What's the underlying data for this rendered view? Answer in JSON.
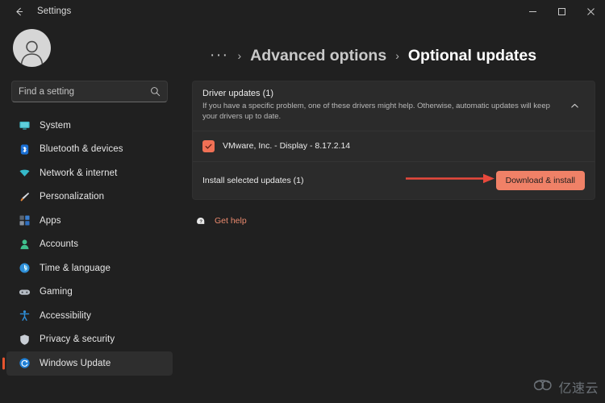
{
  "window": {
    "title": "Settings",
    "back_icon": "back-arrow-icon",
    "controls": {
      "minimize": "minimize-icon",
      "maximize": "maximize-icon",
      "close": "close-icon"
    }
  },
  "sidebar": {
    "avatar": "user-avatar",
    "search": {
      "placeholder": "Find a setting",
      "icon": "search-icon",
      "value": ""
    },
    "items": [
      {
        "label": "System",
        "icon": "monitor-icon",
        "active": false
      },
      {
        "label": "Bluetooth & devices",
        "icon": "bluetooth-icon",
        "active": false
      },
      {
        "label": "Network & internet",
        "icon": "wifi-icon",
        "active": false
      },
      {
        "label": "Personalization",
        "icon": "paintbrush-icon",
        "active": false
      },
      {
        "label": "Apps",
        "icon": "apps-grid-icon",
        "active": false
      },
      {
        "label": "Accounts",
        "icon": "person-icon",
        "active": false
      },
      {
        "label": "Time & language",
        "icon": "clock-icon",
        "active": false
      },
      {
        "label": "Gaming",
        "icon": "gamepad-icon",
        "active": false
      },
      {
        "label": "Accessibility",
        "icon": "accessibility-icon",
        "active": false
      },
      {
        "label": "Privacy & security",
        "icon": "shield-icon",
        "active": false
      },
      {
        "label": "Windows Update",
        "icon": "update-icon",
        "active": true
      }
    ]
  },
  "breadcrumb": {
    "overflow": "···",
    "separator": "›",
    "parent": "Advanced options",
    "current": "Optional updates"
  },
  "driver_card": {
    "title": "Driver updates (1)",
    "description": "If you have a specific problem, one of these drivers might help. Otherwise, automatic updates will keep your drivers up to date.",
    "collapse_icon": "chevron-up-icon",
    "update": {
      "name": "VMware, Inc. - Display - 8.17.2.14",
      "checked": true,
      "checkbox_icon": "checkmark-icon"
    },
    "install_row": {
      "label": "Install selected updates (1)",
      "button_label": "Download & install"
    }
  },
  "get_help": {
    "label": "Get help",
    "icon": "help-question-icon"
  },
  "annotation": {
    "arrow_icon": "red-arrow-right-icon",
    "color": "#e8493c"
  },
  "watermark": {
    "text": "亿速云",
    "icon": "cloud-logo-icon"
  },
  "colors": {
    "accent_button": "#f08167",
    "checkbox": "#f07055",
    "selected_bar": "#e8542e",
    "link": "#eb8a6e",
    "page_bg": "#202020",
    "card_bg": "#2b2b2b"
  }
}
